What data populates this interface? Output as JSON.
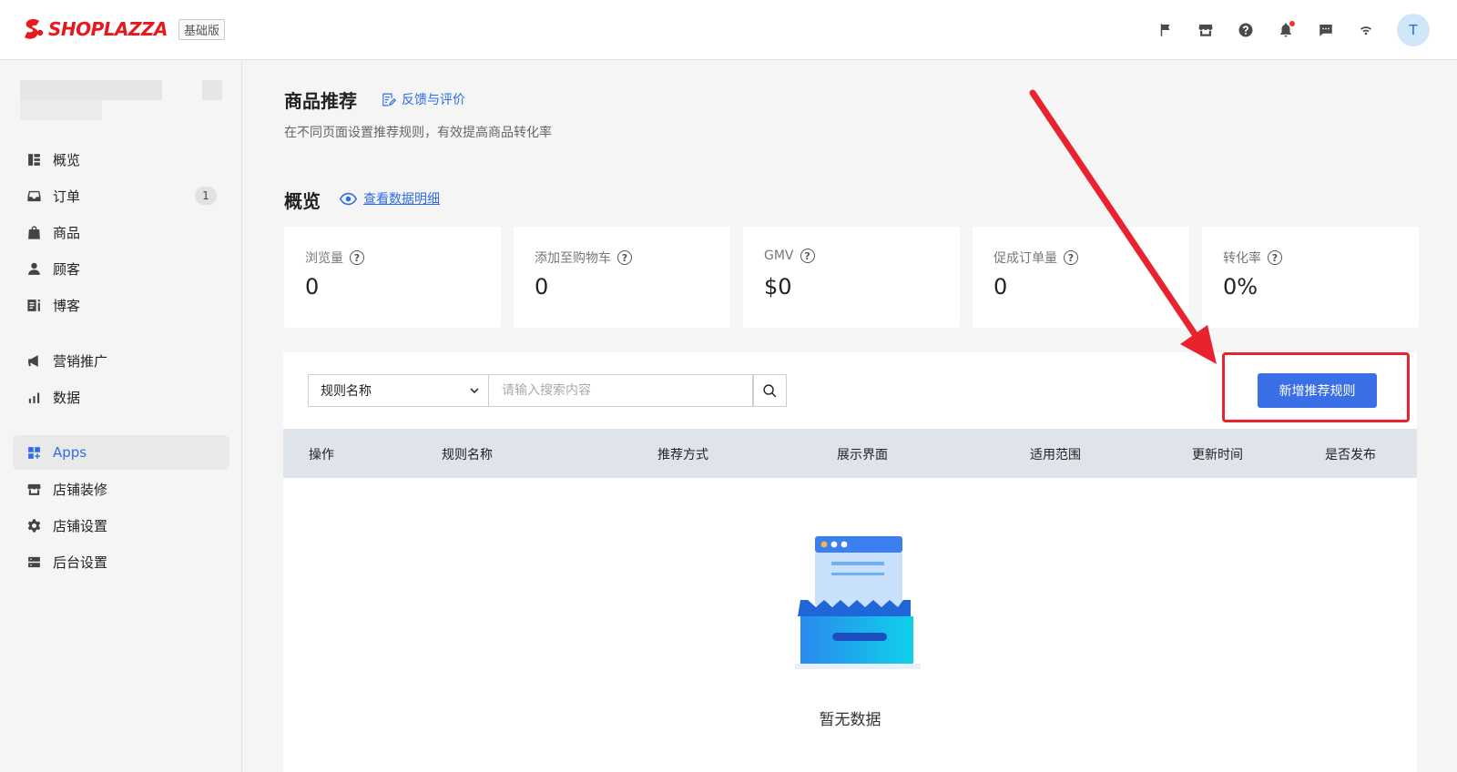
{
  "header": {
    "brand": "SHOPLAZZA",
    "plan_badge": "基础版",
    "icons": [
      "flag-icon",
      "store-icon",
      "help-icon",
      "bell-icon",
      "message-icon",
      "wifi-icon"
    ],
    "avatar_initial": "T"
  },
  "sidebar": {
    "items": [
      {
        "label": "概览",
        "icon": "dashboard-icon"
      },
      {
        "label": "订单",
        "icon": "inbox-icon",
        "count": "1"
      },
      {
        "label": "商品",
        "icon": "bag-icon"
      },
      {
        "label": "顾客",
        "icon": "person-icon"
      },
      {
        "label": "博客",
        "icon": "blog-icon"
      },
      {
        "label": "营销推广",
        "icon": "megaphone-icon"
      },
      {
        "label": "数据",
        "icon": "bar-chart-icon"
      },
      {
        "label": "Apps",
        "icon": "apps-icon",
        "active": true
      },
      {
        "label": "店铺装修",
        "icon": "storefront-icon"
      },
      {
        "label": "店铺设置",
        "icon": "gear-icon"
      },
      {
        "label": "后台设置",
        "icon": "server-icon"
      }
    ]
  },
  "page": {
    "title": "商品推荐",
    "feedback_link": "反馈与评价",
    "description": "在不同页面设置推荐规则，有效提高商品转化率"
  },
  "overview": {
    "title": "概览",
    "detail_link": "查看数据明细",
    "stats": [
      {
        "label": "浏览量",
        "value": "0"
      },
      {
        "label": "添加至购物车",
        "value": "0"
      },
      {
        "label": "GMV",
        "value": "$0"
      },
      {
        "label": "促成订单量",
        "value": "0"
      },
      {
        "label": "转化率",
        "value": "0%"
      }
    ]
  },
  "rules": {
    "filter_selected": "规则名称",
    "search_placeholder": "请输入搜索内容",
    "add_button": "新增推荐规则",
    "columns": [
      "操作",
      "规则名称",
      "推荐方式",
      "展示界面",
      "适用范围",
      "更新时间",
      "是否发布"
    ],
    "empty_text": "暂无数据"
  },
  "colors": {
    "brand_red": "#e8191e",
    "accent_blue": "#3a6fe8",
    "annotation_red": "#e8222e"
  }
}
